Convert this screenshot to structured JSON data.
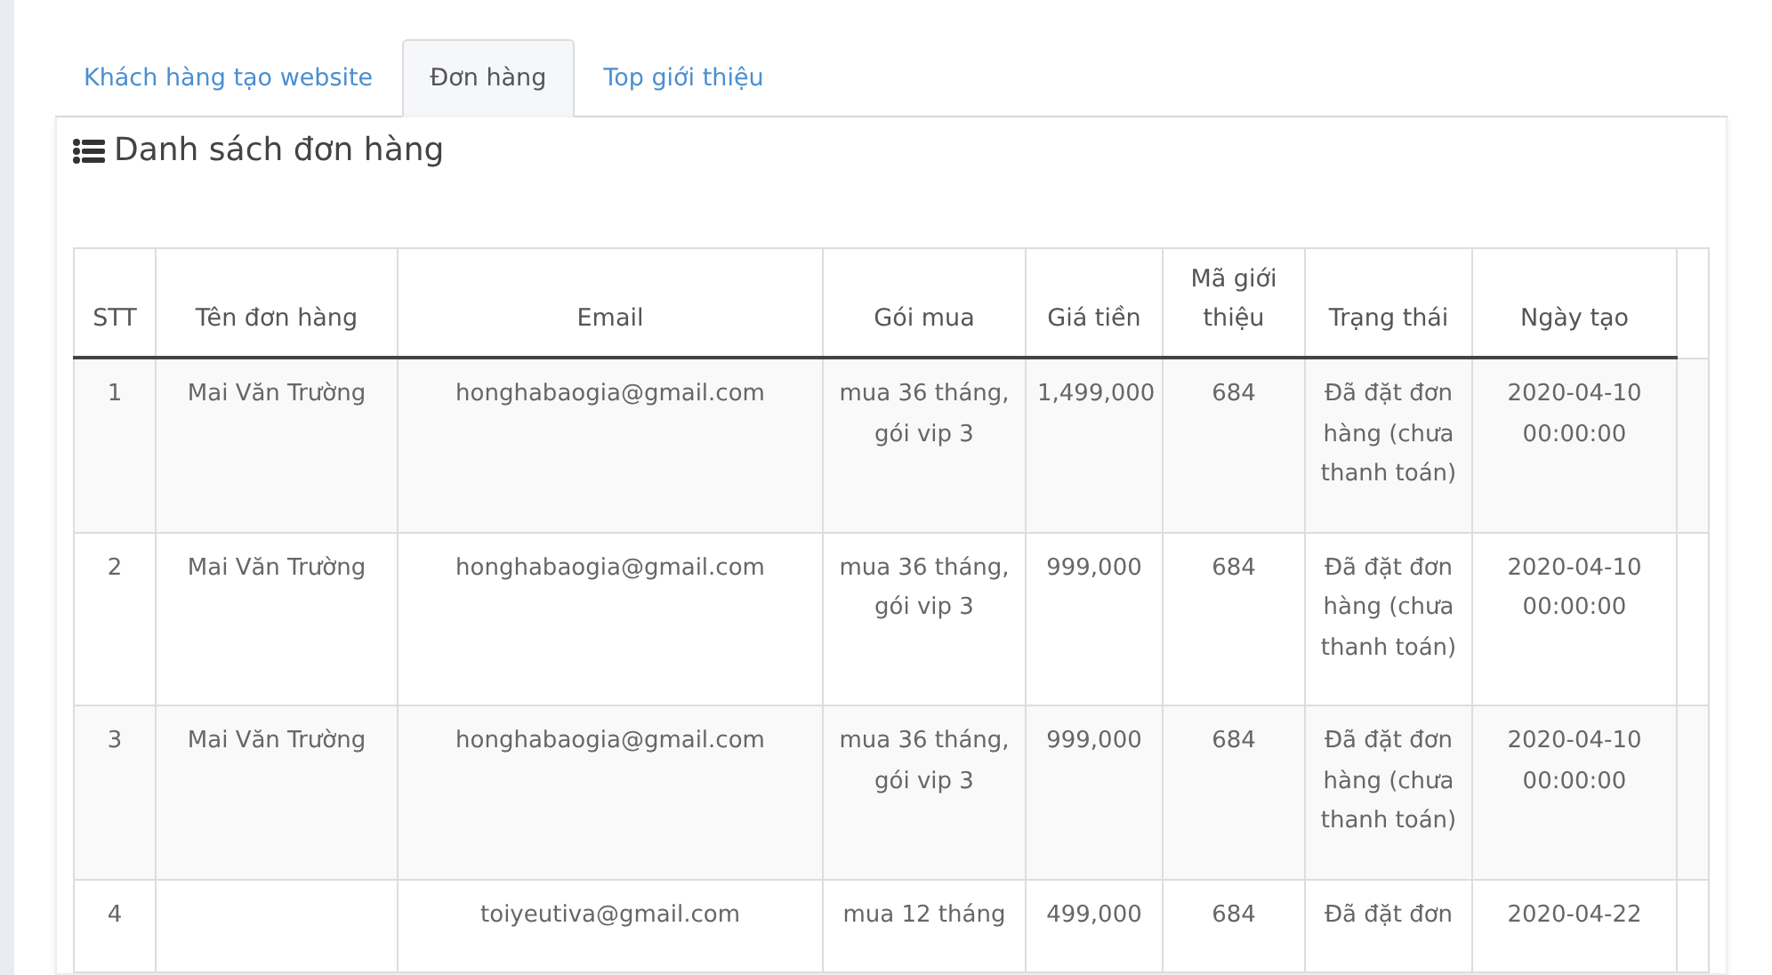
{
  "tabs": [
    {
      "label": "Khách hàng tạo website",
      "selected": false
    },
    {
      "label": "Đơn hàng",
      "selected": true
    },
    {
      "label": "Top giới thiệu",
      "selected": false
    }
  ],
  "panel": {
    "title": "Danh sách đơn hàng"
  },
  "table": {
    "columns": [
      "STT",
      "Tên đơn hàng",
      "Email",
      "Gói mua",
      "Giá tiền",
      "Mã giới thiệu",
      "Trạng thái",
      "Ngày tạo"
    ],
    "rows": [
      {
        "cells": [
          "1",
          "Mai Văn Trường",
          "honghabaogia@gmail.com",
          "mua 36 tháng, gói vip 3",
          "1,499,000",
          "684",
          "Đã đặt đơn hàng (chưa thanh toán)",
          "2020-04-10 00:00:00"
        ]
      },
      {
        "cells": [
          "2",
          "Mai Văn Trường",
          "honghabaogia@gmail.com",
          "mua 36 tháng, gói vip 3",
          "999,000",
          "684",
          "Đã đặt đơn hàng (chưa thanh toán)",
          "2020-04-10 00:00:00"
        ]
      },
      {
        "cells": [
          "3",
          "Mai Văn Trường",
          "honghabaogia@gmail.com",
          "mua 36 tháng, gói vip 3",
          "999,000",
          "684",
          "Đã đặt đơn hàng (chưa thanh toán)",
          "2020-04-10 00:00:00"
        ]
      },
      {
        "cells": [
          "4",
          "",
          "toiyeutiva@gmail.com",
          "mua 12 tháng",
          "499,000",
          "684",
          "Đã đặt đơn",
          "2020-04-22"
        ]
      }
    ]
  }
}
